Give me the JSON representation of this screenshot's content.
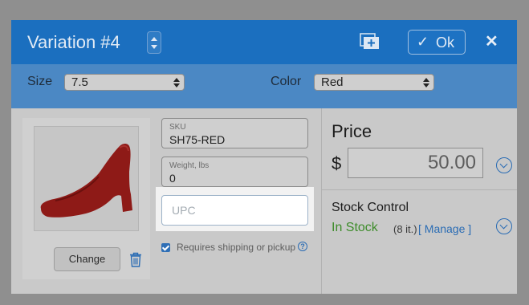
{
  "dialog": {
    "title": "Variation #4",
    "ok_label": "Ok",
    "close_glyph": "✕",
    "check_glyph": "✓"
  },
  "filters": {
    "size_label": "Size",
    "size_value": "7.5",
    "color_label": "Color",
    "color_value": "Red"
  },
  "photo": {
    "change_label": "Change"
  },
  "fields": {
    "sku_label": "SKU",
    "sku_value": "SH75-RED",
    "weight_label": "Weight, lbs",
    "weight_value": "0",
    "upc_placeholder": "UPC"
  },
  "shipping": {
    "label": "Requires shipping or pickup",
    "help": "?"
  },
  "price": {
    "title": "Price",
    "currency": "$",
    "value": "50.00"
  },
  "stock": {
    "title": "Stock Control",
    "status": "In Stock",
    "count": "(8 it.)",
    "manage_label": "[ Manage ]"
  },
  "icons": {
    "stepper": "stepper-icon",
    "add_image": "add-image-icon",
    "trash": "trash-icon",
    "chevron": "chevron-down-circle-icon",
    "help": "help-icon"
  },
  "colors": {
    "header": "#1b6fbf",
    "filter_bar": "#4b88c4",
    "accent": "#2a6cb4",
    "in_stock": "#3d8c2a",
    "shoe": "#8e1a17"
  }
}
